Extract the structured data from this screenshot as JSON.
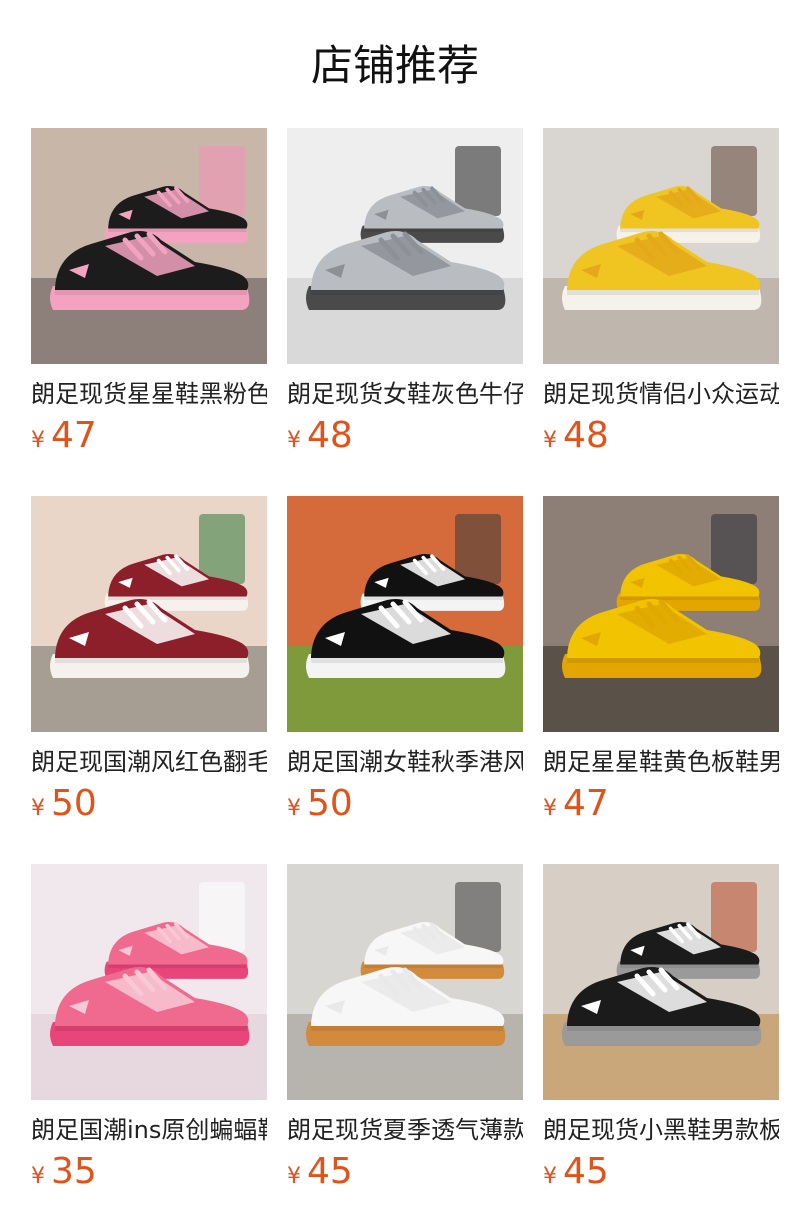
{
  "header": {
    "title": "店铺推荐"
  },
  "currency": "¥",
  "products": [
    {
      "name": "朗足现货星星鞋黑粉色板鞋",
      "price": "47",
      "bg": "#c8b6a8",
      "floor": "#8d7f7a",
      "shoe": "#1c1c1c",
      "accent": "#f3a3c0",
      "sole": "#f3a3c0",
      "extra": "#f58fb6"
    },
    {
      "name": "朗足现货女鞋灰色牛仔面包鞋",
      "price": "48",
      "bg": "#eeeeee",
      "floor": "#d9d9d9",
      "shoe": "#b9bdc1",
      "accent": "#8d9196",
      "sole": "#4a4a4a",
      "extra": "#1d1d1d"
    },
    {
      "name": "朗足现货情侣小众运动鞋",
      "price": "48",
      "bg": "#d9d6d1",
      "floor": "#bfb6ad",
      "shoe": "#f1c521",
      "accent": "#e4a81a",
      "sole": "#f5f2ea",
      "extra": "#5c4433"
    },
    {
      "name": "朗足现国潮风红色翻毛皮板鞋",
      "price": "50",
      "bg": "#e9d6c8",
      "floor": "#a79e93",
      "shoe": "#8c1f2a",
      "accent": "#ffffff",
      "sole": "#f6f1ec",
      "extra": "#2f7c3a"
    },
    {
      "name": "朗足国潮女鞋秋季港风板鞋",
      "price": "50",
      "bg": "#d56a3a",
      "floor": "#7e9a3b",
      "shoe": "#111111",
      "accent": "#ffffff",
      "sole": "#f4f4f4",
      "extra": "#3a3a3a"
    },
    {
      "name": "朗足星星鞋黄色板鞋男女",
      "price": "47",
      "bg": "#8e7f76",
      "floor": "#5a5148",
      "shoe": "#f2c300",
      "accent": "#e0a800",
      "sole": "#e3a500",
      "extra": "#2a2f3a"
    },
    {
      "name": "朗足国潮ins原创蝙蝠鞋",
      "price": "35",
      "bg": "#f0e8ec",
      "floor": "#e7d7de",
      "shoe": "#ef6a8e",
      "accent": "#f7c8d6",
      "sole": "#e8457a",
      "extra": "#ffffff"
    },
    {
      "name": "朗足现货夏季透气薄款白鞋",
      "price": "45",
      "bg": "#d8d6d2",
      "floor": "#b7b4ae",
      "shoe": "#f7f7f7",
      "accent": "#e9e9e9",
      "sole": "#d28a3c",
      "extra": "#3a3a3a"
    },
    {
      "name": "朗足现货小黑鞋男款板鞋",
      "price": "45",
      "bg": "#d7cfc5",
      "floor": "#c9a77a",
      "shoe": "#1b1b1b",
      "accent": "#ffffff",
      "sole": "#9a9a9a",
      "extra": "#b84a2a"
    }
  ]
}
